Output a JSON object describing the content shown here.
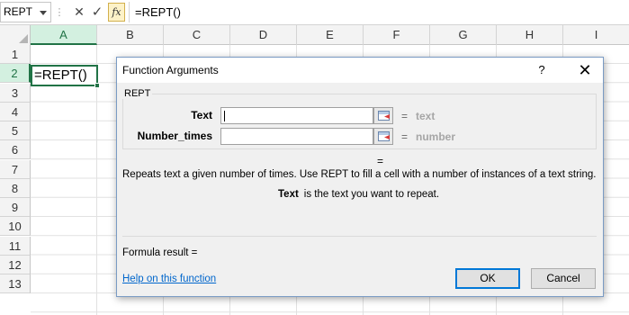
{
  "formula_bar": {
    "name_box": "REPT",
    "separator": "⋮",
    "cancel_icon": "✕",
    "enter_icon": "✓",
    "fx_label": "fx",
    "formula": "=REPT()"
  },
  "grid": {
    "columns": [
      "A",
      "B",
      "C",
      "D",
      "E",
      "F",
      "G",
      "H",
      "I"
    ],
    "rows": [
      "1",
      "2",
      "3",
      "4",
      "5",
      "6",
      "7",
      "8",
      "9",
      "10",
      "11",
      "12",
      "13"
    ],
    "active_column": "A",
    "active_row": "2",
    "active_cell_value": "=REPT()"
  },
  "dialog": {
    "title": "Function Arguments",
    "help_symbol": "?",
    "close_symbol": "✕",
    "function_name": "REPT",
    "arguments": [
      {
        "label": "Text",
        "value": "",
        "equals": "=",
        "hint": "text"
      },
      {
        "label": "Number_times",
        "value": "",
        "equals": "=",
        "hint": "number"
      }
    ],
    "result_equals": "=",
    "description": "Repeats text a given number of times. Use REPT to fill a cell with a number of instances of a text string.",
    "arg_desc_name": "Text",
    "arg_desc_text": "is the text you want to repeat.",
    "formula_result": "Formula result =",
    "help_link": "Help on this function",
    "ok_label": "OK",
    "cancel_label": "Cancel"
  },
  "colors": {
    "excel_green": "#217346",
    "header_bg": "#f3f3f3",
    "dialog_bg": "#f0f0f0",
    "link": "#0066cc",
    "hint_gray": "#a6a6a6"
  }
}
